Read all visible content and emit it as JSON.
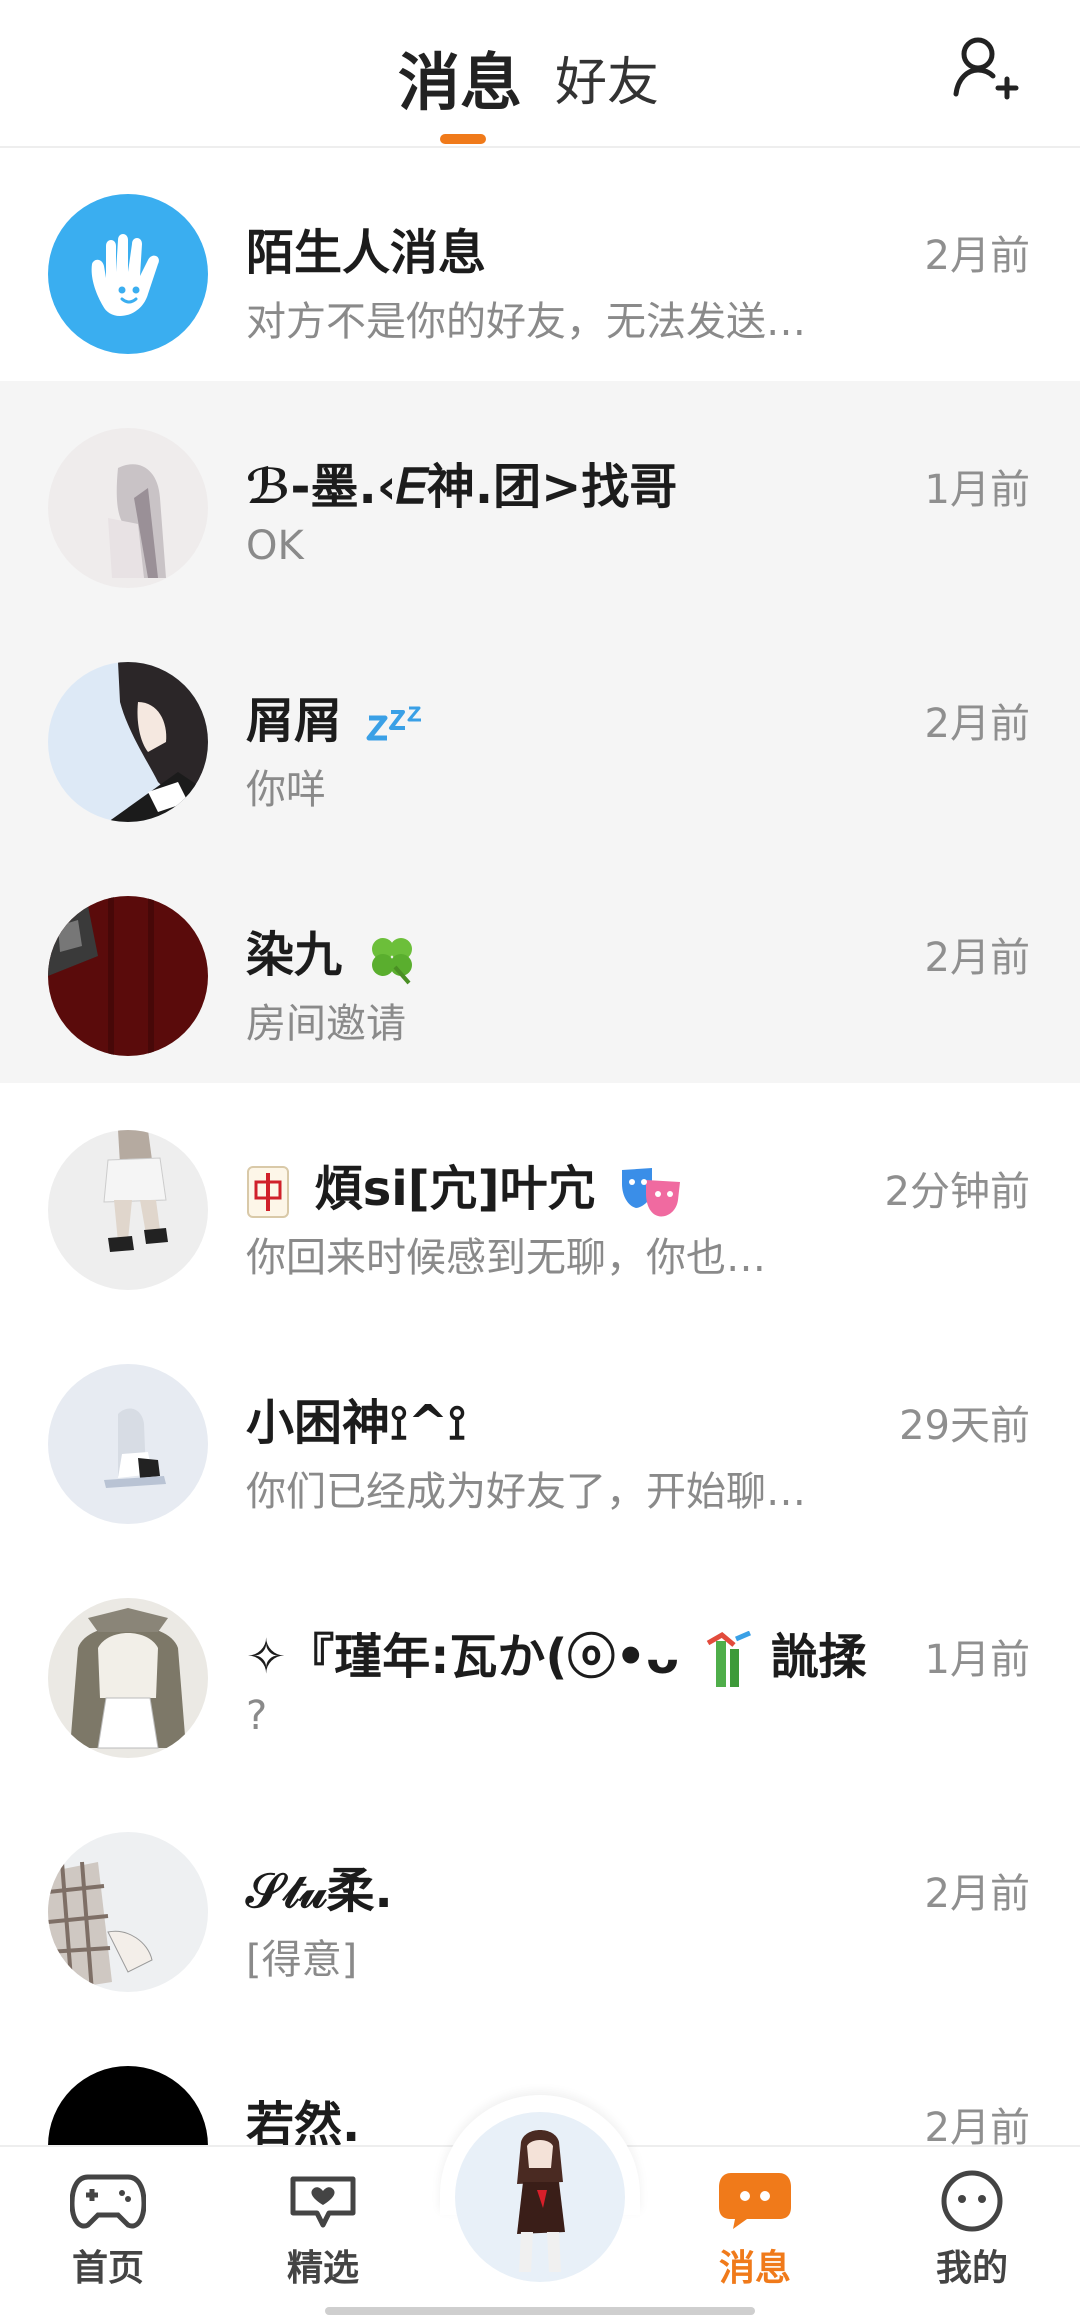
{
  "header": {
    "tab_messages": "消息",
    "tab_friends": "好友",
    "add_friend_icon": "add-user-icon"
  },
  "conversations": [
    {
      "name": "陌生人消息",
      "preview": "对方不是你的好友，无法发送…",
      "time": "2月前",
      "avatar": "stranger-hand-icon",
      "accent": "#3aaef0"
    },
    {
      "name": "ℬ-墨.‹𝐸神.团>找哥",
      "preview": "OK",
      "time": "1月前",
      "avatar": "anime-girl-avatar"
    },
    {
      "name": "屑屑",
      "preview": "你咩",
      "time": "2月前",
      "avatar": "anime-boy-avatar",
      "emoji": "zzz-icon"
    },
    {
      "name": "染九",
      "preview": "房间邀请",
      "time": "2月前",
      "avatar": "dark-red-avatar",
      "emoji": "clover-icon"
    },
    {
      "name": "煩si[宂]叶宂",
      "preview": "你回来时候感到无聊，你也…",
      "time": "2分钟前",
      "avatar": "anime-legs-avatar",
      "prefix_emoji": "mahjong-icon",
      "emoji": "masks-icon"
    },
    {
      "name": "小困神⟟^⟟",
      "preview": "你们已经成为好友了，开始聊…",
      "time": "29天前",
      "avatar": "sitting-girl-avatar"
    },
    {
      "name": "✧『瑾年:瓦か(ⓞ•ᴗ",
      "name_suffix": "詤揉",
      "preview": "?",
      "time": "1月前",
      "avatar": "braids-girl-avatar",
      "emoji": "bamboo-icon"
    },
    {
      "name": "𝒮𝓉𝓊柔.",
      "preview": "[得意]",
      "time": "2月前",
      "avatar": "plaid-avatar"
    },
    {
      "name": "若然.",
      "preview": "",
      "time": "2月前",
      "avatar": "black-avatar"
    }
  ],
  "bottom_nav": [
    {
      "label": "首页",
      "icon": "gamepad-icon"
    },
    {
      "label": "精选",
      "icon": "heart-chat-icon"
    },
    {
      "label": "",
      "icon": "profile-photo"
    },
    {
      "label": "消息",
      "icon": "chat-bubble-icon",
      "active": true
    },
    {
      "label": "我的",
      "icon": "smiley-icon"
    }
  ],
  "colors": {
    "accent": "#f07a1a",
    "stranger_blue": "#3aaef0",
    "highlight_bg": "#f5f5f5"
  }
}
